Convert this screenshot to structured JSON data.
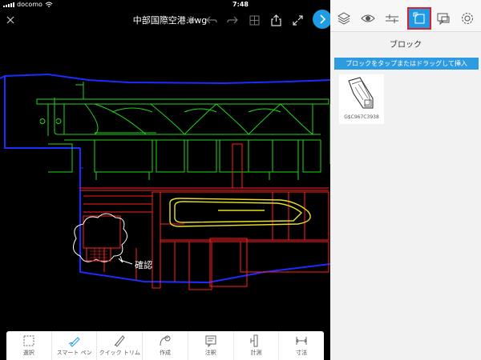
{
  "status": {
    "carrier": "docomo",
    "time": "7:48"
  },
  "toolbar": {
    "file_title": "中部国際空港.dwg"
  },
  "canvas": {
    "annotation_label": "確認"
  },
  "bottom_tools": [
    {
      "label": "選択",
      "icon": "select-icon"
    },
    {
      "label": "スマート ペン",
      "icon": "smart-pen-icon"
    },
    {
      "label": "クイック トリム",
      "icon": "quick-trim-icon"
    },
    {
      "label": "作成",
      "icon": "create-icon"
    },
    {
      "label": "注釈",
      "icon": "annotate-icon"
    },
    {
      "label": "計測",
      "icon": "measure-icon"
    },
    {
      "label": "寸法",
      "icon": "dimension-icon"
    }
  ],
  "panel": {
    "title": "ブロック",
    "hint": "ブロックをタップまたはドラッグして挿入",
    "blocks": [
      {
        "name": "G$C967C3938"
      }
    ]
  },
  "colors": {
    "accent": "#1e9be2",
    "highlight": "#e0202a"
  }
}
